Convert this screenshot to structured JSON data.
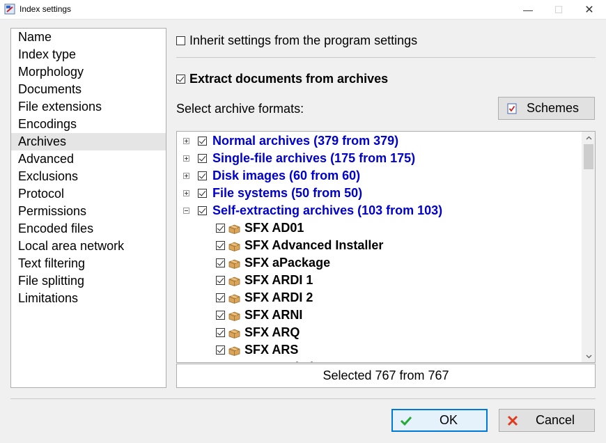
{
  "window": {
    "title": "Index settings",
    "minimize_glyph": "—",
    "maximize_glyph": "☐",
    "close_glyph": "✕"
  },
  "nav": {
    "items": [
      {
        "label": "Name"
      },
      {
        "label": "Index type"
      },
      {
        "label": "Morphology"
      },
      {
        "label": "Documents"
      },
      {
        "label": "File extensions"
      },
      {
        "label": "Encodings"
      },
      {
        "label": "Archives",
        "selected": true
      },
      {
        "label": "Advanced"
      },
      {
        "label": "Exclusions"
      },
      {
        "label": "Protocol"
      },
      {
        "label": "Permissions"
      },
      {
        "label": "Encoded files"
      },
      {
        "label": "Local area network"
      },
      {
        "label": "Text filtering"
      },
      {
        "label": "File splitting"
      },
      {
        "label": "Limitations"
      }
    ]
  },
  "settings": {
    "inherit_label": "Inherit settings from the program settings",
    "inherit_checked": false,
    "extract_label": "Extract documents from archives",
    "extract_checked": true,
    "select_formats_label": "Select archive formats:",
    "schemes_label": "Schemes"
  },
  "tree": {
    "rows": [
      {
        "label": "Normal archives (379 from 379)",
        "group": true,
        "expanded": false,
        "checked": true
      },
      {
        "label": "Single-file archives (175 from 175)",
        "group": true,
        "expanded": false,
        "checked": true
      },
      {
        "label": "Disk images (60 from 60)",
        "group": true,
        "expanded": false,
        "checked": true
      },
      {
        "label": "File systems (50 from 50)",
        "group": true,
        "expanded": false,
        "checked": true
      },
      {
        "label": "Self-extracting archives (103 from 103)",
        "group": true,
        "expanded": true,
        "checked": true
      },
      {
        "label": "SFX AD01",
        "group": false,
        "checked": true
      },
      {
        "label": "SFX Advanced Installer",
        "group": false,
        "checked": true
      },
      {
        "label": "SFX aPackage",
        "group": false,
        "checked": true
      },
      {
        "label": "SFX ARDI 1",
        "group": false,
        "checked": true
      },
      {
        "label": "SFX ARDI 2",
        "group": false,
        "checked": true
      },
      {
        "label": "SFX ARNI",
        "group": false,
        "checked": true
      },
      {
        "label": "SFX ARQ",
        "group": false,
        "checked": true
      },
      {
        "label": "SFX ARS",
        "group": false,
        "checked": true
      },
      {
        "label": "SFX BackZipMaster",
        "group": false,
        "checked": true
      }
    ]
  },
  "status": {
    "text": "Selected 767 from 767"
  },
  "buttons": {
    "ok_label": "OK",
    "cancel_label": "Cancel"
  },
  "colors": {
    "accent": "#0078d7",
    "group_text": "#0000cc",
    "selected_bg": "#e5e5e5"
  }
}
